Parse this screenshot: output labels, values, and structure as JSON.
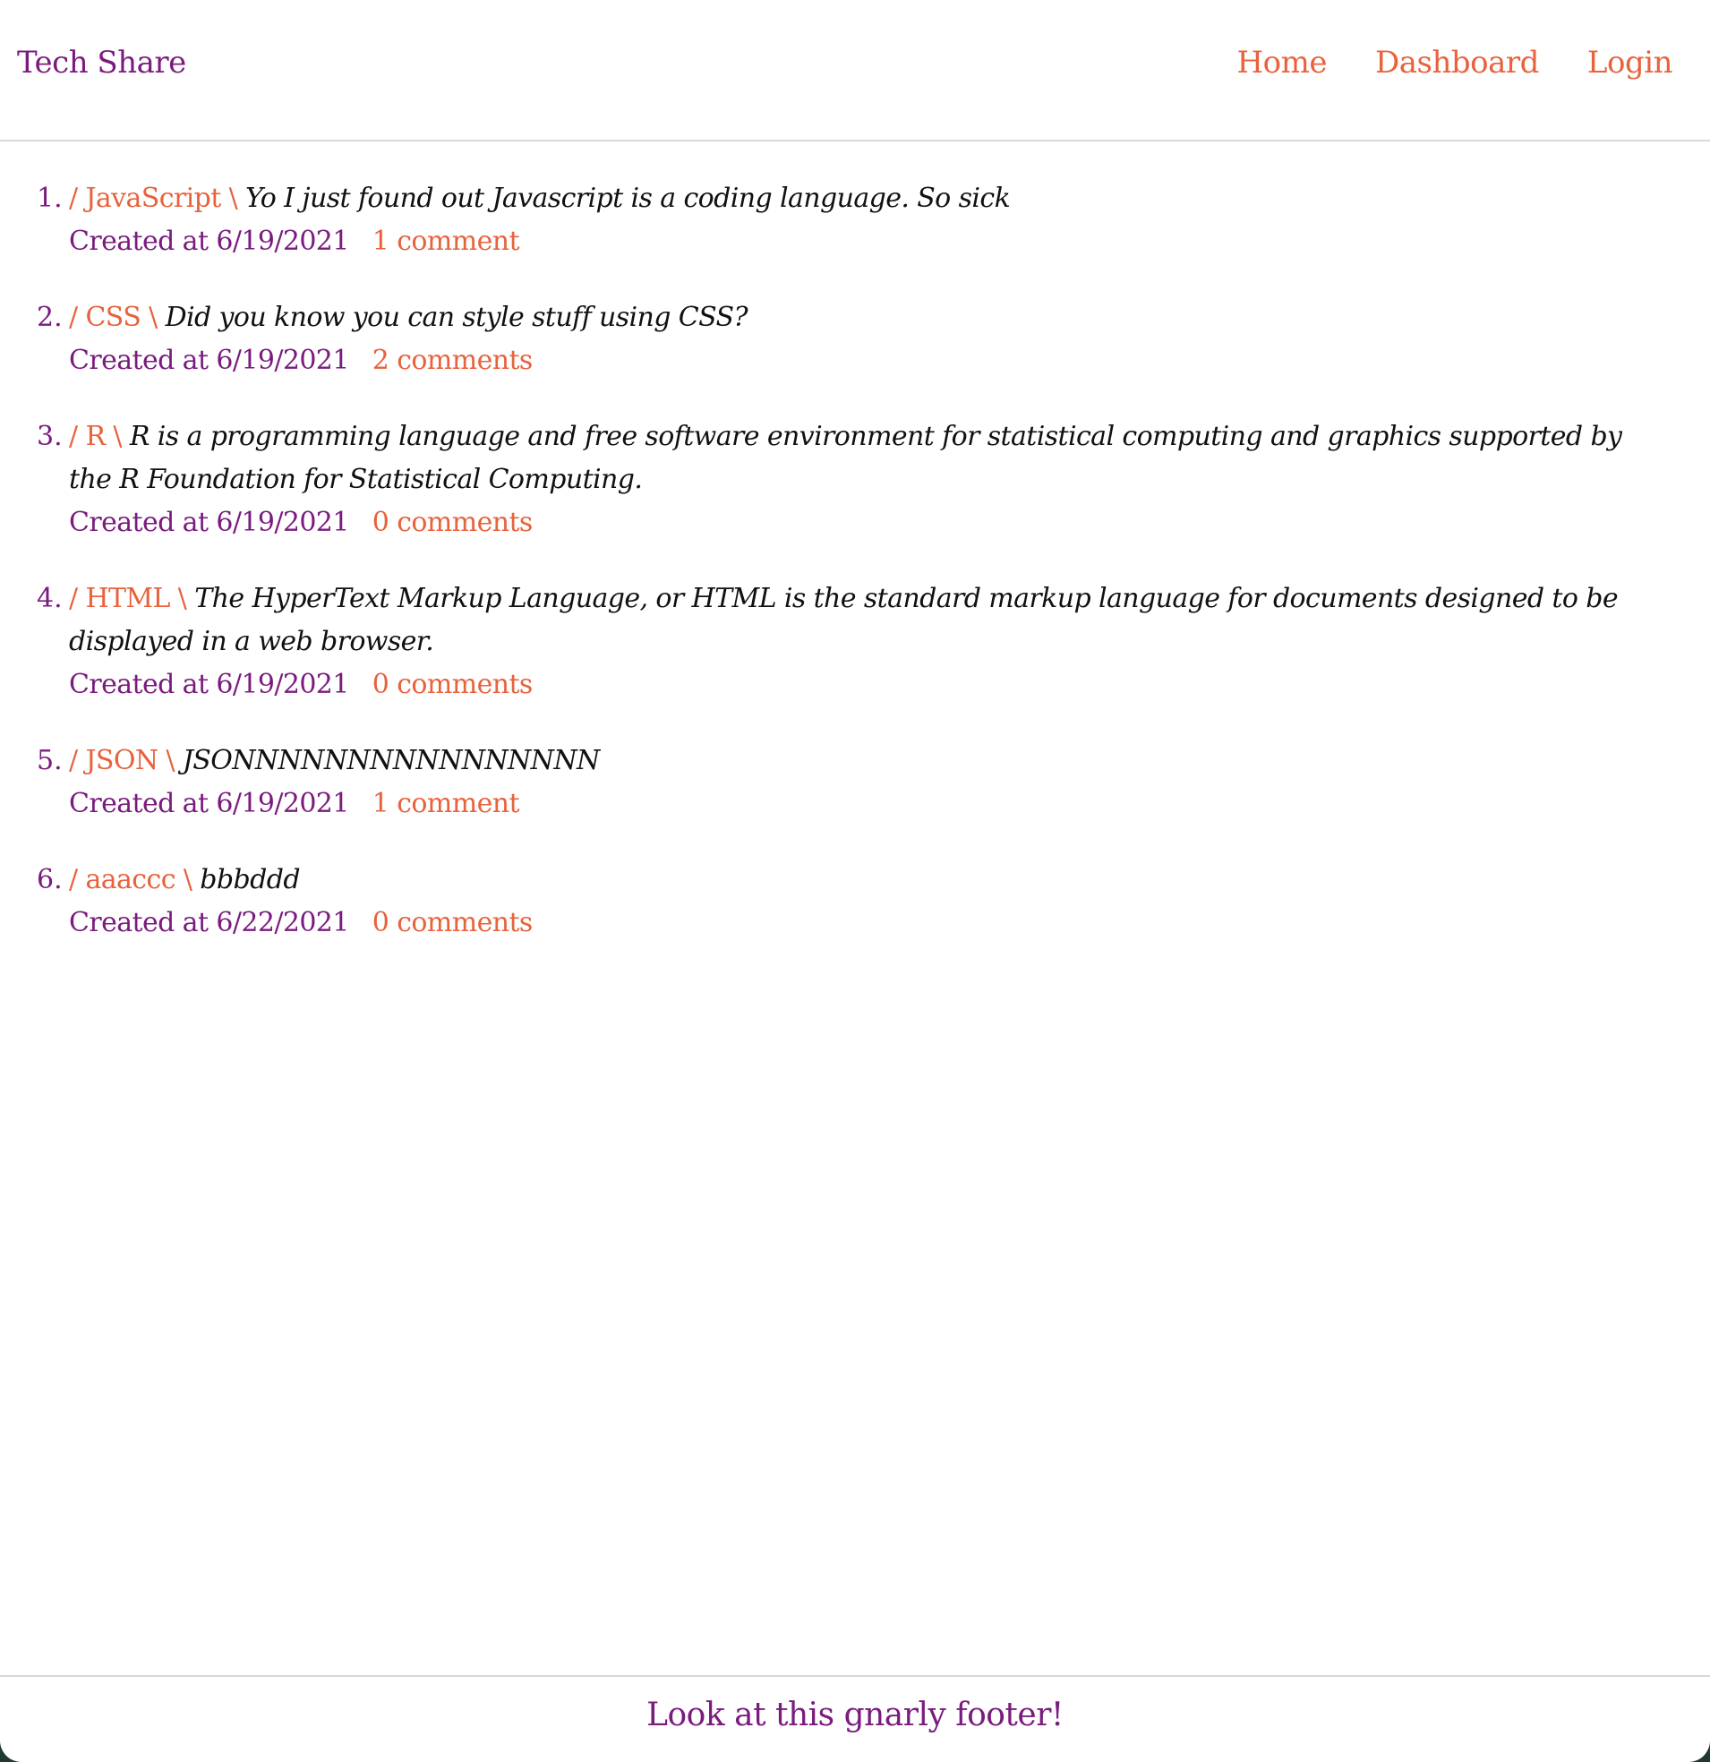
{
  "header": {
    "brand": "Tech Share",
    "nav": {
      "home": "Home",
      "dashboard": "Dashboard",
      "login": "Login"
    }
  },
  "posts": [
    {
      "topic": "/ JavaScript \\",
      "content": "Yo I just found out Javascript is a coding language. So sick",
      "created": "Created at 6/19/2021",
      "comments": "1 comment"
    },
    {
      "topic": "/ CSS \\",
      "content": "Did you know you can style stuff using CSS?",
      "created": "Created at 6/19/2021",
      "comments": "2 comments"
    },
    {
      "topic": "/ R \\",
      "content": "R is a programming language and free software environment for statistical computing and graphics supported by the R Foundation for Statistical Computing.",
      "created": "Created at 6/19/2021",
      "comments": "0 comments"
    },
    {
      "topic": "/ HTML \\",
      "content": "The HyperText Markup Language, or HTML is the standard markup language for documents designed to be displayed in a web browser.",
      "created": "Created at 6/19/2021",
      "comments": "0 comments"
    },
    {
      "topic": "/ JSON \\",
      "content": "JSONNNNNNNNNNNNNNNN",
      "created": "Created at 6/19/2021",
      "comments": "1 comment"
    },
    {
      "topic": "/ aaaccc \\",
      "content": "bbbddd",
      "created": "Created at 6/22/2021",
      "comments": "0 comments"
    }
  ],
  "footer": {
    "text": "Look at this gnarly footer!"
  },
  "colors": {
    "brand_purple": "#7a1b7e",
    "accent_orange": "#e8623c",
    "text_black": "#111111",
    "divider": "#d9d9d9"
  }
}
